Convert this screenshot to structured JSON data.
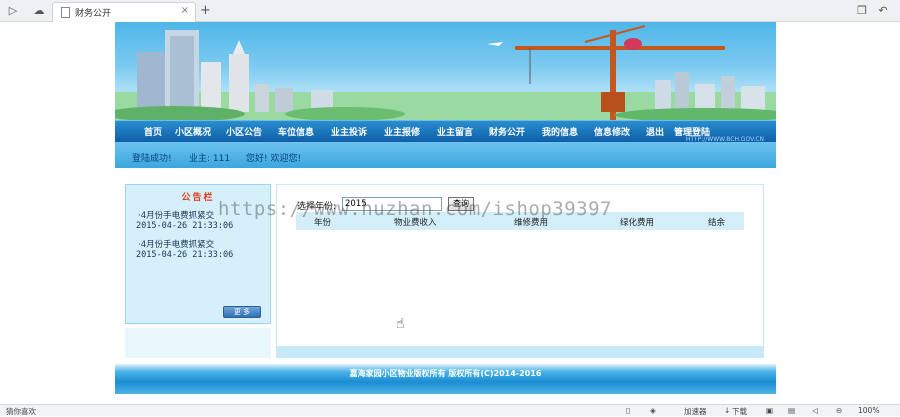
{
  "browser": {
    "tab_title": "财务公开",
    "tab_close": "×",
    "new_tab": "+"
  },
  "nav": {
    "items": [
      "首页",
      "小区概况",
      "小区公告",
      "车位信息",
      "业主投诉",
      "业主报修",
      "业主留言",
      "财务公开",
      "我的信息",
      "信息修改",
      "退出",
      "管理登陆"
    ],
    "banner_url": "HTTP://WWW.BCH.GOV.CN"
  },
  "welcome": {
    "login_ok": "登陆成功!",
    "owner": "业主: 111",
    "greeting": "您好! 欢迎您!"
  },
  "sidebar": {
    "title": "公告栏",
    "news": [
      {
        "title": "·4月份手电费抓紧交",
        "date": "2015-04-26 21:33:06"
      },
      {
        "title": "·4月份手电费抓紧交",
        "date": "2015-04-26 21:33:06"
      }
    ],
    "more_label": "更 多"
  },
  "query": {
    "year_label": "选择年份:",
    "year_value": "2015",
    "button_label": "查询"
  },
  "table": {
    "headers": [
      "年份",
      "物业费收入",
      "维修费用",
      "绿化费用",
      "结余"
    ],
    "rows": []
  },
  "footer": {
    "copyright": "嘉海家园小区物业版权所有 版权所有(C)2014-2016"
  },
  "statusbar": {
    "left_text": "猜你喜欢",
    "accelerator": "加速器",
    "download": "下载",
    "zoom": "100%"
  },
  "watermark": "https://www.huzhan.com/ishop39397",
  "colors": {
    "nav_bg": "#0e5ea8",
    "welcome_bg": "#3ba6de",
    "sidebar_bg": "#d6f0fb",
    "table_header_bg": "#d3eef8",
    "title_red": "#e03a1a"
  }
}
